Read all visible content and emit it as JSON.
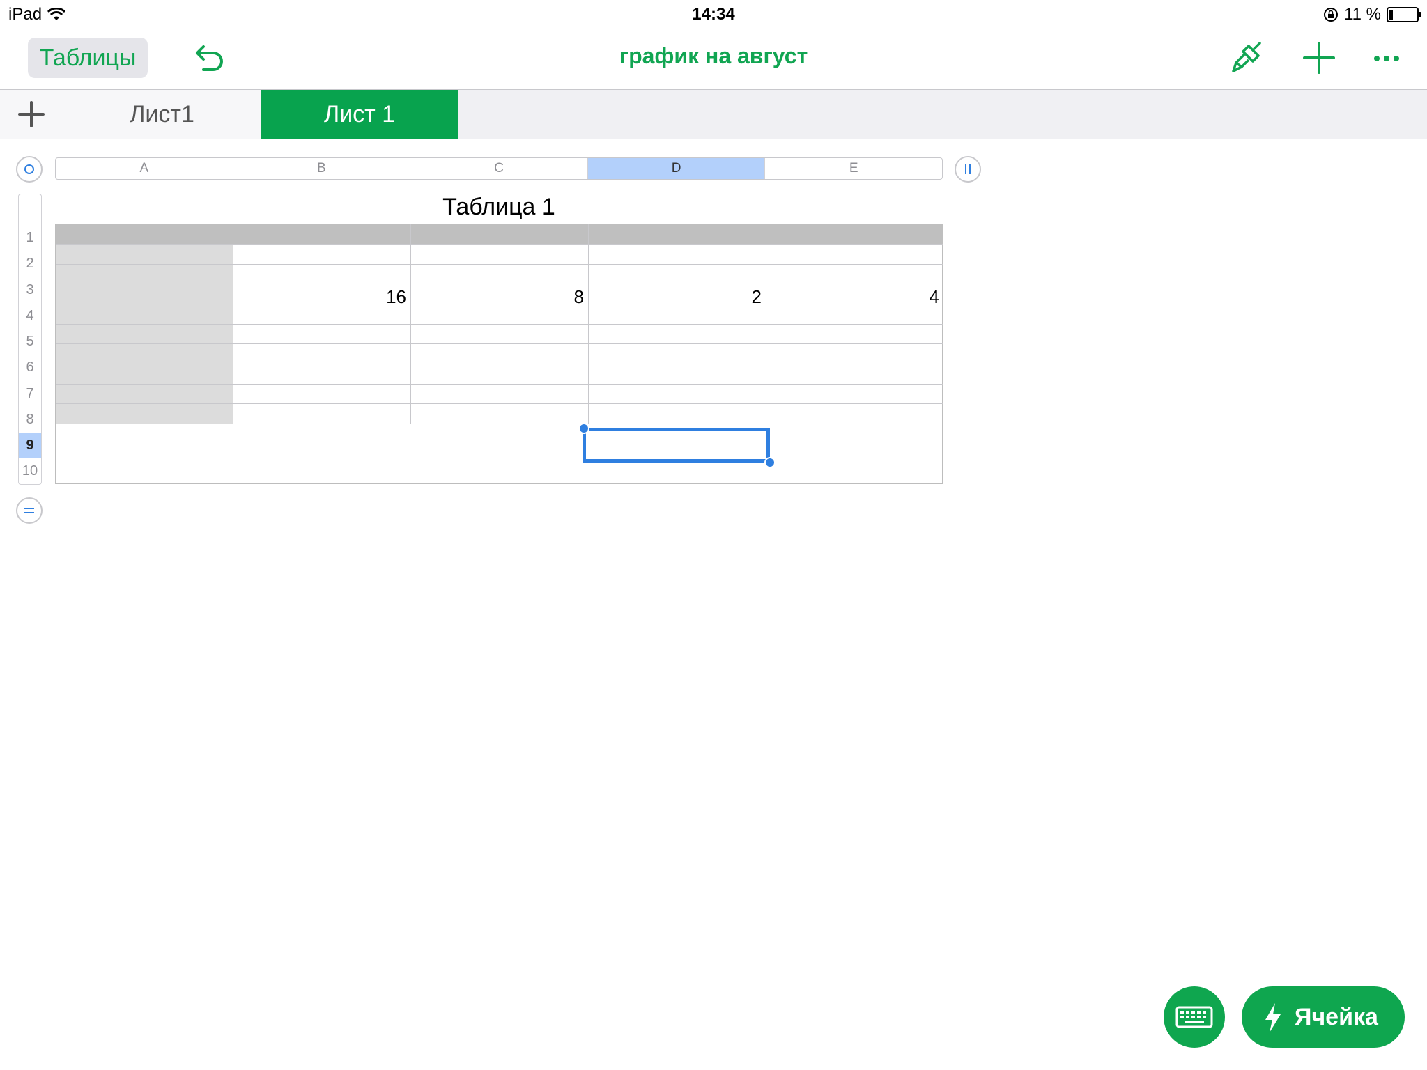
{
  "status_bar": {
    "device": "iPad",
    "time": "14:34",
    "battery": "11 %"
  },
  "toolbar": {
    "back_label": "Таблицы",
    "title": "график на  август"
  },
  "sheets": {
    "tabs": [
      {
        "label": "Лист1",
        "active": false
      },
      {
        "label": "Лист 1",
        "active": true
      }
    ]
  },
  "table": {
    "title": "Таблица 1",
    "columns": [
      "A",
      "B",
      "C",
      "D",
      "E"
    ],
    "selected_column": "D",
    "rows": [
      "1",
      "2",
      "3",
      "4",
      "5",
      "6",
      "7",
      "8",
      "9",
      "10"
    ],
    "selected_row": "9",
    "row4_values": [
      "16",
      "8",
      "2",
      "4"
    ]
  },
  "bottom": {
    "cell_button_label": "Ячейка"
  },
  "colors": {
    "accent": "#11a552",
    "active_tab": "#08a34e",
    "selection": "#2f7fe0",
    "header_fill": "#bfbfbf",
    "label_col_fill": "#dcdcdc"
  }
}
